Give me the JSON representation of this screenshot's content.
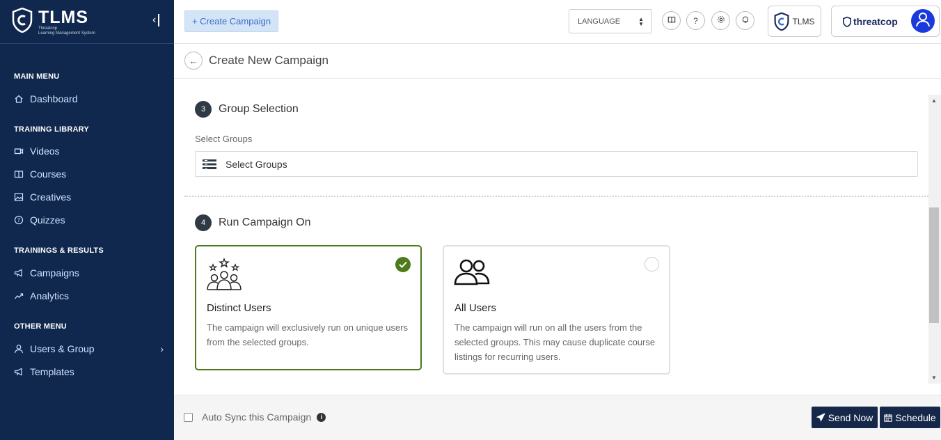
{
  "app": {
    "logo_title": "TLMS",
    "logo_sub_1": "Threatcop",
    "logo_sub_2": "Learning Management System"
  },
  "sidebar": {
    "sections": [
      {
        "title": "MAIN MENU",
        "items": [
          {
            "label": "Dashboard",
            "icon": "home-icon"
          }
        ]
      },
      {
        "title": "TRAINING LIBRARY",
        "items": [
          {
            "label": "Videos",
            "icon": "video-icon"
          },
          {
            "label": "Courses",
            "icon": "book-icon"
          },
          {
            "label": "Creatives",
            "icon": "image-icon"
          },
          {
            "label": "Quizzes",
            "icon": "question-circle-icon"
          }
        ]
      },
      {
        "title": "TRAININGS & RESULTS",
        "items": [
          {
            "label": "Campaigns",
            "icon": "megaphone-icon"
          },
          {
            "label": "Analytics",
            "icon": "chart-line-icon"
          }
        ]
      },
      {
        "title": "OTHER MENU",
        "items": [
          {
            "label": "Users & Group",
            "icon": "user-icon"
          },
          {
            "label": "Templates",
            "icon": "megaphone-icon"
          }
        ]
      }
    ]
  },
  "topbar": {
    "create_label": "+ Create Campaign",
    "language_label": "LANGUAGE",
    "tlms_label": "TLMS",
    "brand_label": "threatcop"
  },
  "page": {
    "title": "Create New Campaign"
  },
  "steps": {
    "group": {
      "number": "3",
      "title": "Group Selection",
      "field_label": "Select Groups",
      "select_text": "Select Groups"
    },
    "run_on": {
      "number": "4",
      "title": "Run Campaign On",
      "options": [
        {
          "title": "Distinct Users",
          "desc": "The campaign will exclusively run on unique users from the selected groups.",
          "selected": true
        },
        {
          "title": "All Users",
          "desc": "The campaign will run on all the users from the selected groups. This may cause duplicate course listings for recurring users.",
          "selected": false
        }
      ]
    }
  },
  "footer": {
    "autosync_label": "Auto Sync this Campaign",
    "send_label": "Send Now",
    "schedule_label": "Schedule"
  },
  "colors": {
    "sidebar_bg": "#10284e",
    "selected_green": "#4d7a1a",
    "primary_dark": "#16284a"
  }
}
